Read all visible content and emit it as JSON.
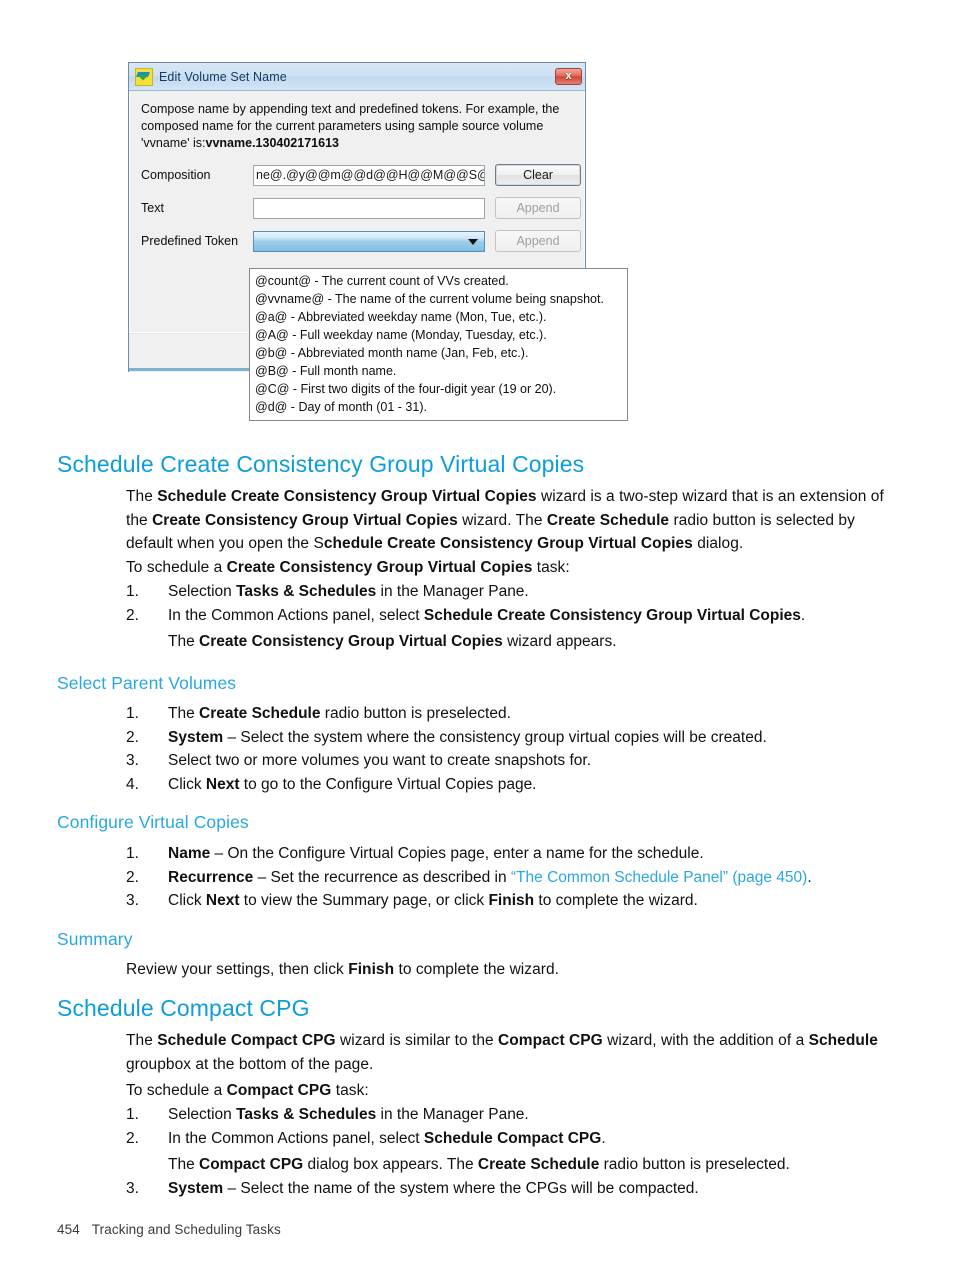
{
  "dialog": {
    "title": "Edit Volume Set Name",
    "icon": "volume-set-icon",
    "close_label": "x",
    "intro_line1": "Compose name by appending text and predefined tokens. For example, the",
    "intro_line2": "composed name for the current parameters using sample source volume",
    "intro_line3_prefix": "'vvname' is:",
    "intro_line3_bold": "vvname.130402171613",
    "fields": {
      "composition_label": "Composition",
      "composition_value": "ne@.@y@@m@@d@@H@@M@@S@",
      "composition_button": "Clear",
      "text_label": "Text",
      "text_value": "",
      "text_button": "Append",
      "token_label": "Predefined Token",
      "token_value": "",
      "token_button": "Append"
    },
    "dropdown_items": [
      "@count@ - The current count of VVs created.",
      "@vvname@ - The name of the current volume being snapshot.",
      "@a@ - Abbreviated weekday name (Mon, Tue, etc.).",
      "@A@ - Full weekday name (Monday, Tuesday, etc.).",
      "@b@ - Abbreviated month name (Jan, Feb, etc.).",
      "@B@ - Full month name.",
      "@C@ - First two digits of the four-digit year (19 or 20).",
      "@d@ - Day of month (01 - 31)."
    ]
  },
  "doc": {
    "section1": {
      "heading": "Schedule Create Consistency Group Virtual Copies",
      "para1": {
        "t1": "The ",
        "b1": "Schedule Create Consistency Group Virtual Copies",
        "t2": " wizard is a two-step wizard that is an extension of the ",
        "b2": "Create Consistency Group Virtual Copies",
        "t3": " wizard. The ",
        "b3": "Create Schedule",
        "t4": " radio button is selected by default when you open the S",
        "b4": "chedule Create Consistency Group Virtual Copies",
        "t5": " dialog."
      },
      "para2": {
        "t1": "To schedule a ",
        "b1": "Create Consistency Group Virtual Copies",
        "t2": " task:"
      },
      "steps": [
        {
          "num": "1.",
          "t1": "Selection ",
          "b1": "Tasks & Schedules",
          "t2": " in the Manager Pane."
        },
        {
          "num": "2.",
          "t1": "In the Common Actions panel, select ",
          "b1": "Schedule Create Consistency Group Virtual Copies",
          "t2": ".",
          "sub_t1": "The ",
          "sub_b1": "Create Consistency Group Virtual Copies",
          "sub_t2": " wizard appears."
        }
      ]
    },
    "subsection_parent": {
      "heading": "Select Parent Volumes",
      "steps": [
        {
          "num": "1.",
          "t1": "The ",
          "b1": "Create Schedule",
          "t2": " radio button is preselected."
        },
        {
          "num": "2.",
          "t1": "",
          "b1": "System",
          "t2": " – Select the system where the consistency group virtual copies will be created."
        },
        {
          "num": "3.",
          "t1": "Select two or more volumes you want to create snapshots for.",
          "b1": "",
          "t2": ""
        },
        {
          "num": "4.",
          "t1": "Click ",
          "b1": "Next",
          "t2": " to go to the Configure Virtual Copies page."
        }
      ]
    },
    "subsection_configure": {
      "heading": "Configure Virtual Copies",
      "steps": [
        {
          "num": "1.",
          "t1": "",
          "b1": "Name",
          "t2": " – On the Configure Virtual Copies page, enter a name for the schedule."
        },
        {
          "num": "2.",
          "t1": "",
          "b1": "Recurrence",
          "t2": " – Set the recurrence as described in ",
          "link": "“The Common Schedule Panel” (page 450)",
          "t3": "."
        },
        {
          "num": "3.",
          "t1": "Click ",
          "b1": "Next",
          "t2": " to view the Summary page, or click ",
          "b2": "Finish",
          "t3": " to complete the wizard."
        }
      ]
    },
    "subsection_summary": {
      "heading": "Summary",
      "para": {
        "t1": "Review your settings, then click ",
        "b1": "Finish",
        "t2": " to complete the wizard."
      }
    },
    "section2": {
      "heading": "Schedule Compact CPG",
      "para1": {
        "t1": "The ",
        "b1": "Schedule Compact CPG",
        "t2": " wizard is similar to the ",
        "b2": "Compact CPG",
        "t3": " wizard, with the addition of a ",
        "b3": "Schedule",
        "t4": " groupbox at the bottom of the page."
      },
      "para2": {
        "t1": "To schedule a ",
        "b1": "Compact CPG",
        "t2": " task:"
      },
      "steps": [
        {
          "num": "1.",
          "t1": "Selection ",
          "b1": "Tasks & Schedules",
          "t2": " in the Manager Pane."
        },
        {
          "num": "2.",
          "t1": "In the Common Actions panel, select ",
          "b1": "Schedule Compact CPG",
          "t2": ".",
          "sub_t1": "The ",
          "sub_b1": "Compact CPG",
          "sub_t2": " dialog box appears. The ",
          "sub_b2": "Create Schedule",
          "sub_t3": " radio button is preselected."
        },
        {
          "num": "3.",
          "t1": "",
          "b1": "System",
          "t2": " – Select the name of the system where the CPGs will be compacted."
        }
      ]
    },
    "footer": {
      "page_number": "454",
      "chapter": "Tracking and Scheduling Tasks"
    }
  },
  "colors": {
    "heading_blue": "#0d9ddb",
    "subheading_blue": "#29a8e0",
    "link_blue": "#29a8e0"
  }
}
